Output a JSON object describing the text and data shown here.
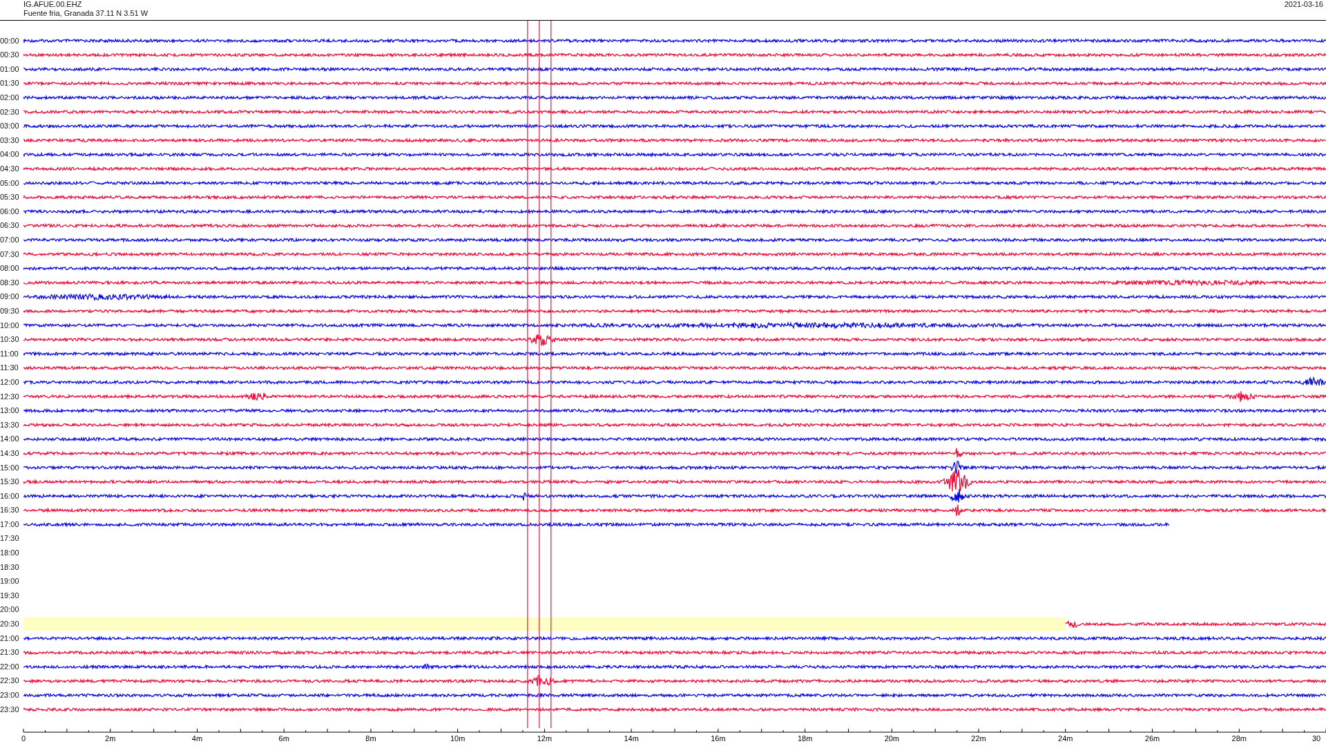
{
  "header": {
    "station": "IG.AFUE.00.EHZ",
    "location": "Fuente fria, Granada  37.11 N 3.51 W",
    "date": "2021-03-16"
  },
  "rows": [
    {
      "label": "00:00",
      "kind": "trace",
      "color": "#0a0ae6",
      "highlighted": false
    },
    {
      "label": "00:30",
      "kind": "trace",
      "color": "#f0103c",
      "highlighted": false
    },
    {
      "label": "01:00",
      "kind": "trace",
      "color": "#0a0ae6",
      "highlighted": false
    },
    {
      "label": "01:30",
      "kind": "trace",
      "color": "#f0103c",
      "highlighted": false
    },
    {
      "label": "02:00",
      "kind": "trace",
      "color": "#0a0ae6",
      "highlighted": false
    },
    {
      "label": "02:30",
      "kind": "trace",
      "color": "#f0103c",
      "highlighted": false
    },
    {
      "label": "03:00",
      "kind": "trace",
      "color": "#0a0ae6",
      "highlighted": false
    },
    {
      "label": "03:30",
      "kind": "trace",
      "color": "#f0103c",
      "highlighted": false
    },
    {
      "label": "04:00",
      "kind": "trace",
      "color": "#0a0ae6",
      "highlighted": false
    },
    {
      "label": "04:30",
      "kind": "trace",
      "color": "#f0103c",
      "highlighted": false
    },
    {
      "label": "05:00",
      "kind": "trace",
      "color": "#0a0ae6",
      "highlighted": false
    },
    {
      "label": "05:30",
      "kind": "trace",
      "color": "#f0103c",
      "highlighted": false
    },
    {
      "label": "06:00",
      "kind": "trace",
      "color": "#0a0ae6",
      "highlighted": false
    },
    {
      "label": "06:30",
      "kind": "trace",
      "color": "#f0103c",
      "highlighted": false
    },
    {
      "label": "07:00",
      "kind": "trace",
      "color": "#0a0ae6",
      "highlighted": false
    },
    {
      "label": "07:30",
      "kind": "trace",
      "color": "#f0103c",
      "highlighted": false
    },
    {
      "label": "08:00",
      "kind": "trace",
      "color": "#0a0ae6",
      "highlighted": false
    },
    {
      "label": "08:30",
      "kind": "trace",
      "color": "#f0103c",
      "highlighted": false
    },
    {
      "label": "09:00",
      "kind": "trace",
      "color": "#0a0ae6",
      "highlighted": false
    },
    {
      "label": "09:30",
      "kind": "trace",
      "color": "#f0103c",
      "highlighted": false
    },
    {
      "label": "10:00",
      "kind": "trace",
      "color": "#0a0ae6",
      "highlighted": false
    },
    {
      "label": "10:30",
      "kind": "trace",
      "color": "#f0103c",
      "highlighted": false
    },
    {
      "label": "11:00",
      "kind": "trace",
      "color": "#0a0ae6",
      "highlighted": false
    },
    {
      "label": "11:30",
      "kind": "trace",
      "color": "#f0103c",
      "highlighted": false
    },
    {
      "label": "12:00",
      "kind": "trace",
      "color": "#0a0ae6",
      "highlighted": false
    },
    {
      "label": "12:30",
      "kind": "trace",
      "color": "#f0103c",
      "highlighted": false
    },
    {
      "label": "13:00",
      "kind": "trace",
      "color": "#0a0ae6",
      "highlighted": false
    },
    {
      "label": "13:30",
      "kind": "trace",
      "color": "#f0103c",
      "highlighted": false
    },
    {
      "label": "14:00",
      "kind": "trace",
      "color": "#0a0ae6",
      "highlighted": false
    },
    {
      "label": "14:30",
      "kind": "trace",
      "color": "#f0103c",
      "highlighted": false
    },
    {
      "label": "15:00",
      "kind": "trace",
      "color": "#0a0ae6",
      "highlighted": false
    },
    {
      "label": "15:30",
      "kind": "trace",
      "color": "#f0103c",
      "highlighted": false
    },
    {
      "label": "16:00",
      "kind": "trace",
      "color": "#0a0ae6",
      "highlighted": false
    },
    {
      "label": "16:30",
      "kind": "trace",
      "color": "#f0103c",
      "highlighted": false
    },
    {
      "label": "17:00",
      "kind": "ending",
      "color": "#0a0ae6",
      "highlighted": false
    },
    {
      "label": "17:30",
      "kind": "empty",
      "highlighted": false
    },
    {
      "label": "18:00",
      "kind": "empty",
      "highlighted": false
    },
    {
      "label": "18:30",
      "kind": "empty",
      "highlighted": false
    },
    {
      "label": "19:00",
      "kind": "empty",
      "highlighted": false
    },
    {
      "label": "19:30",
      "kind": "empty",
      "highlighted": false
    },
    {
      "label": "20:00",
      "kind": "empty",
      "highlighted": false
    },
    {
      "label": "20:30",
      "kind": "starting",
      "color": "#f0103c",
      "highlighted": true
    },
    {
      "label": "21:00",
      "kind": "trace",
      "color": "#0a0ae6",
      "highlighted": false
    },
    {
      "label": "21:30",
      "kind": "trace",
      "color": "#f0103c",
      "highlighted": false
    },
    {
      "label": "22:00",
      "kind": "trace",
      "color": "#0a0ae6",
      "highlighted": false
    },
    {
      "label": "22:30",
      "kind": "trace",
      "color": "#f0103c",
      "highlighted": false
    },
    {
      "label": "23:00",
      "kind": "trace",
      "color": "#0a0ae6",
      "highlighted": false
    },
    {
      "label": "23:30",
      "kind": "trace",
      "color": "#f0103c",
      "highlighted": false
    }
  ],
  "axis": {
    "ticks": [
      "0",
      "2m",
      "4m",
      "6m",
      "8m",
      "10m",
      "12m",
      "14m",
      "16m",
      "18m",
      "20m",
      "22m",
      "24m",
      "26m",
      "28m",
      "30"
    ]
  }
}
